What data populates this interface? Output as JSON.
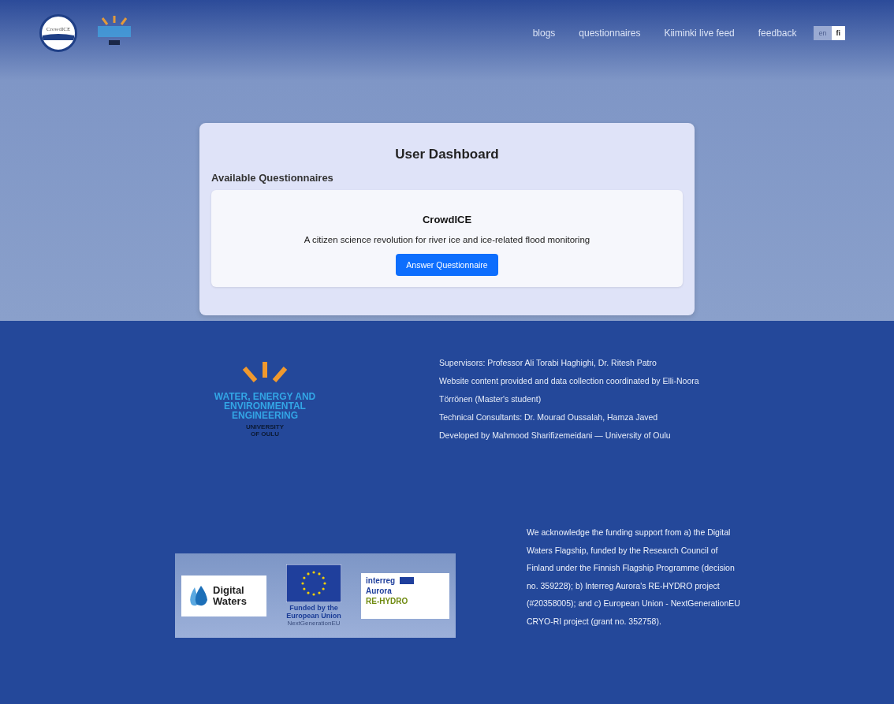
{
  "header": {
    "logo_text": "CrowdICE",
    "nav": [
      "blogs",
      "questionnaires",
      "Kiiminki live feed",
      "feedback"
    ],
    "languages": [
      {
        "label": "en",
        "selected": false
      },
      {
        "label": "fi",
        "selected": true
      }
    ]
  },
  "dashboard": {
    "title": "User Dashboard",
    "section": "Available Questionnaires",
    "questionnaires": [
      {
        "title": "CrowdICE",
        "description": "A citizen science revolution for river ice and ice-related flood monitoring",
        "button": "Answer Questionnaire"
      }
    ]
  },
  "footer": {
    "logo": {
      "name": "WATER, ENERGY AND ENVIRONMENTAL ENGINEERING",
      "university": "UNIVERSITY OF OULU"
    },
    "credits": [
      "Supervisors: Professor Ali Torabi Haghighi, Dr. Ritesh Patro",
      "Website content provided and data collection coordinated by Elli-Noora Törrönen (Master's student)",
      "Technical Consultants: Dr. Mourad Oussalah, Hamza Javed",
      "Developed by Mahmood Sharifizemeidani — University of Oulu"
    ],
    "funders": {
      "digital_waters": "Digital Waters",
      "eu": "Funded by the European Union",
      "eu_sub": "NextGenerationEU",
      "interreg": "interreg",
      "aurora": "Aurora",
      "project": "RE-HYDRO"
    },
    "acknowledgement": "We acknowledge the funding support from a) the Digital Waters Flagship, funded by the Research Council of Finland under the Finnish Flagship Programme (decision no. 359228); b) Interreg Aurora's RE-HYDRO project (#20358005); and c) European Union - NextGenerationEU CRYO-RI project (grant no. 352758)."
  }
}
